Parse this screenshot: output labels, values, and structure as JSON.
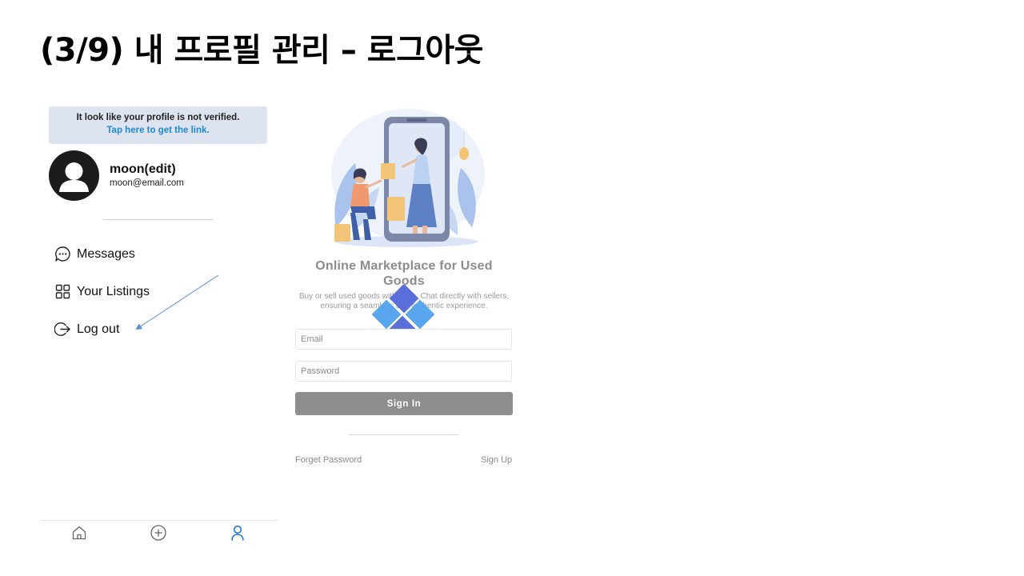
{
  "slide": {
    "title": "(3/9) 내 프로필 관리 – 로그아웃"
  },
  "profile_screen": {
    "banner": {
      "message": "It look like your profile is not verified.",
      "link_text": "Tap here to get the link."
    },
    "user": {
      "name": "moon(edit)",
      "email": "moon@email.com"
    },
    "menu": [
      {
        "label": "Messages",
        "icon": "chat-bubble-icon"
      },
      {
        "label": "Your Listings",
        "icon": "grid-icon"
      },
      {
        "label": "Log out",
        "icon": "logout-icon"
      }
    ],
    "tabbar": [
      {
        "icon": "home-icon",
        "active": false
      },
      {
        "icon": "add-circle-icon",
        "active": false
      },
      {
        "icon": "profile-icon",
        "active": true
      }
    ]
  },
  "login_screen": {
    "title": "Online Marketplace for Used Goods",
    "subtitle": "Buy or sell used goods with ease. Chat directly with sellers, ensuring a seamless and authentic experience.",
    "email_placeholder": "Email",
    "password_placeholder": "Password",
    "sign_in_label": "Sign In",
    "forget_password": "Forget Password",
    "sign_up": "Sign Up"
  },
  "colors": {
    "banner_bg": "#dde4ef",
    "link_blue": "#1e88d6",
    "active_tab": "#1f7ad6",
    "button_gray": "#8e8e8e",
    "logo_dark": "#5b6fdc",
    "logo_light": "#5aa6ee",
    "annotation_arrow": "#5b8fd0"
  }
}
